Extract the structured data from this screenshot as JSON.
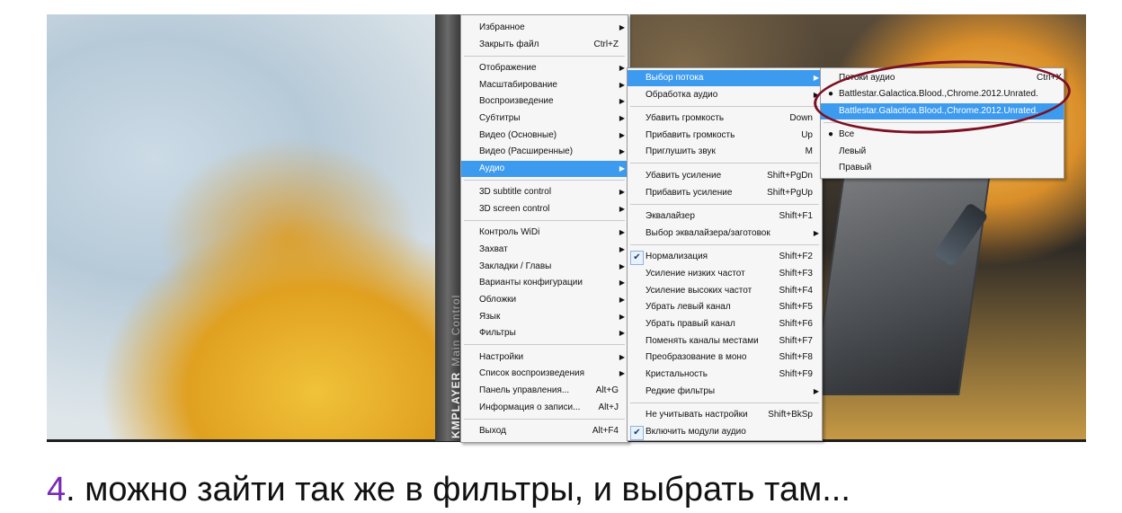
{
  "player": {
    "brand": "KMPLAYER",
    "panel": "Main Control"
  },
  "main_menu": {
    "items": [
      {
        "label": "Избранное",
        "submenu": true
      },
      {
        "label": "Закрыть файл",
        "shortcut": "Ctrl+Z"
      },
      {
        "label": "Отображение",
        "submenu": true
      },
      {
        "label": "Масштабирование",
        "submenu": true
      },
      {
        "label": "Воспроизведение",
        "submenu": true
      },
      {
        "label": "Субтитры",
        "submenu": true
      },
      {
        "label": "Видео (Основные)",
        "submenu": true
      },
      {
        "label": "Видео (Расширенные)",
        "submenu": true
      },
      {
        "label": "Аудио",
        "submenu": true,
        "highlighted": true
      },
      {
        "label": "3D subtitle control",
        "submenu": true
      },
      {
        "label": "3D screen control",
        "submenu": true
      },
      {
        "label": "Контроль WiDi",
        "submenu": true
      },
      {
        "label": "Захват",
        "submenu": true
      },
      {
        "label": "Закладки / Главы",
        "submenu": true
      },
      {
        "label": "Варианты конфигурации",
        "submenu": true
      },
      {
        "label": "Обложки",
        "submenu": true
      },
      {
        "label": "Язык",
        "submenu": true
      },
      {
        "label": "Фильтры",
        "submenu": true
      },
      {
        "label": "Настройки",
        "submenu": true
      },
      {
        "label": "Список воспроизведения",
        "submenu": true
      },
      {
        "label": "Панель управления...",
        "shortcut": "Alt+G"
      },
      {
        "label": "Информация о записи...",
        "shortcut": "Alt+J"
      },
      {
        "label": "Выход",
        "shortcut": "Alt+F4"
      }
    ]
  },
  "audio_menu": {
    "items": [
      {
        "label": "Выбор потока",
        "submenu": true,
        "highlighted": true
      },
      {
        "label": "Обработка аудио",
        "submenu": true
      },
      {
        "label": "Убавить громкость",
        "shortcut": "Down"
      },
      {
        "label": "Прибавить громкость",
        "shortcut": "Up"
      },
      {
        "label": "Приглушить звук",
        "shortcut": "M"
      },
      {
        "label": "Убавить усиление",
        "shortcut": "Shift+PgDn"
      },
      {
        "label": "Прибавить усиление",
        "shortcut": "Shift+PgUp"
      },
      {
        "label": "Эквалайзер",
        "shortcut": "Shift+F1"
      },
      {
        "label": "Выбор эквалайзера/заготовок",
        "submenu": true
      },
      {
        "label": "Нормализация",
        "shortcut": "Shift+F2",
        "checked": true
      },
      {
        "label": "Усиление низких частот",
        "shortcut": "Shift+F3"
      },
      {
        "label": "Усиление высоких частот",
        "shortcut": "Shift+F4"
      },
      {
        "label": "Убрать левый канал",
        "shortcut": "Shift+F5"
      },
      {
        "label": "Убрать правый канал",
        "shortcut": "Shift+F6"
      },
      {
        "label": "Поменять каналы местами",
        "shortcut": "Shift+F7"
      },
      {
        "label": "Преобразование в моно",
        "shortcut": "Shift+F8"
      },
      {
        "label": "Кристальность",
        "shortcut": "Shift+F9"
      },
      {
        "label": "Редкие фильтры",
        "submenu": true
      },
      {
        "label": "Не учитывать настройки",
        "shortcut": "Shift+BkSp"
      },
      {
        "label": "Включить модули аудио",
        "checked": true
      }
    ]
  },
  "stream_menu": {
    "items": [
      {
        "label": "Потоки аудио",
        "shortcut": "Ctrl+X"
      },
      {
        "label": "Battlestar.Galactica.Blood.,Chrome.2012.Unrated.",
        "selected": true
      },
      {
        "label": "Battlestar.Galactica.Blood.,Chrome.2012.Unrated.",
        "highlighted": true
      },
      {
        "label": "Все",
        "selected": true
      },
      {
        "label": "Левый"
      },
      {
        "label": "Правый"
      }
    ]
  },
  "caption": {
    "number": "4",
    "text": ". можно зайти так же в фильтры, и выбрать там..."
  },
  "colors": {
    "highlight": "#3d9bef",
    "circle": "#7c1023",
    "caption_number": "#7a2ab5"
  },
  "icons": {
    "submenu": "triangle-right-icon",
    "check": "checkmark-icon",
    "radio": "bullet-icon"
  }
}
